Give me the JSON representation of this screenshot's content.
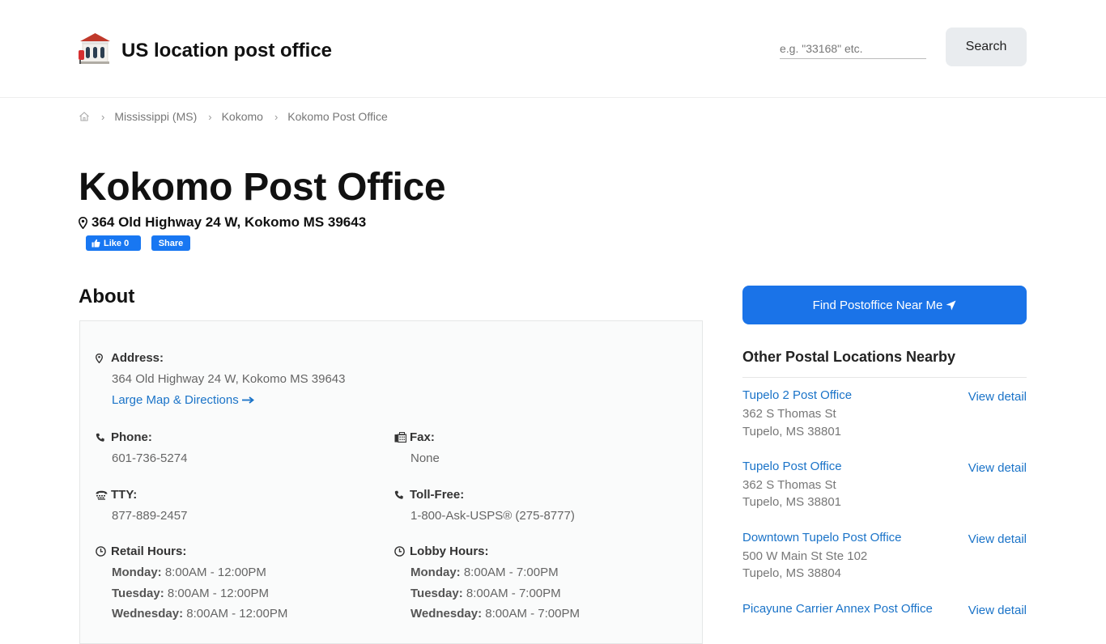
{
  "header": {
    "site_title": "US location post office",
    "search_placeholder": "e.g. \"33168\" etc.",
    "search_label": "Search"
  },
  "breadcrumb": [
    "Mississippi (MS)",
    "Kokomo",
    "Kokomo Post Office"
  ],
  "page": {
    "title": "Kokomo Post Office",
    "address": "364 Old Highway 24 W, Kokomo MS 39643",
    "fb_like": "Like 0",
    "fb_share": "Share"
  },
  "about": {
    "title": "About",
    "address_label": "Address:",
    "address_value": "364 Old Highway 24 W, Kokomo MS 39643",
    "map_link": "Large Map & Directions",
    "phone_label": "Phone:",
    "phone_value": "601-736-5274",
    "fax_label": "Fax:",
    "fax_value": "None",
    "tty_label": "TTY:",
    "tty_value": "877-889-2457",
    "tollfree_label": "Toll-Free:",
    "tollfree_value": "1-800-Ask-USPS® (275-8777)",
    "retail_label": "Retail Hours:",
    "retail_hours": [
      {
        "day": "Monday:",
        "time": "8:00AM - 12:00PM"
      },
      {
        "day": "Tuesday:",
        "time": "8:00AM - 12:00PM"
      },
      {
        "day": "Wednesday:",
        "time": "8:00AM - 12:00PM"
      }
    ],
    "lobby_label": "Lobby Hours:",
    "lobby_hours": [
      {
        "day": "Monday:",
        "time": "8:00AM - 7:00PM"
      },
      {
        "day": "Tuesday:",
        "time": "8:00AM - 7:00PM"
      },
      {
        "day": "Wednesday:",
        "time": "8:00AM - 7:00PM"
      }
    ]
  },
  "sidebar": {
    "find_button": "Find Postoffice Near Me",
    "nearby_title": "Other Postal Locations Nearby",
    "view_label": "View detail",
    "locations": [
      {
        "name": "Tupelo 2 Post Office",
        "street": "362 S Thomas St",
        "city": "Tupelo, MS 38801"
      },
      {
        "name": "Tupelo Post Office",
        "street": "362 S Thomas St",
        "city": "Tupelo, MS 38801"
      },
      {
        "name": "Downtown Tupelo Post Office",
        "street": "500 W Main St Ste 102",
        "city": "Tupelo, MS 38804"
      },
      {
        "name": "Picayune Carrier Annex Post Office",
        "street": "",
        "city": ""
      }
    ]
  },
  "colors": {
    "accent": "#1a73e8",
    "link": "#1a73c8",
    "facebook": "#1877f2"
  }
}
